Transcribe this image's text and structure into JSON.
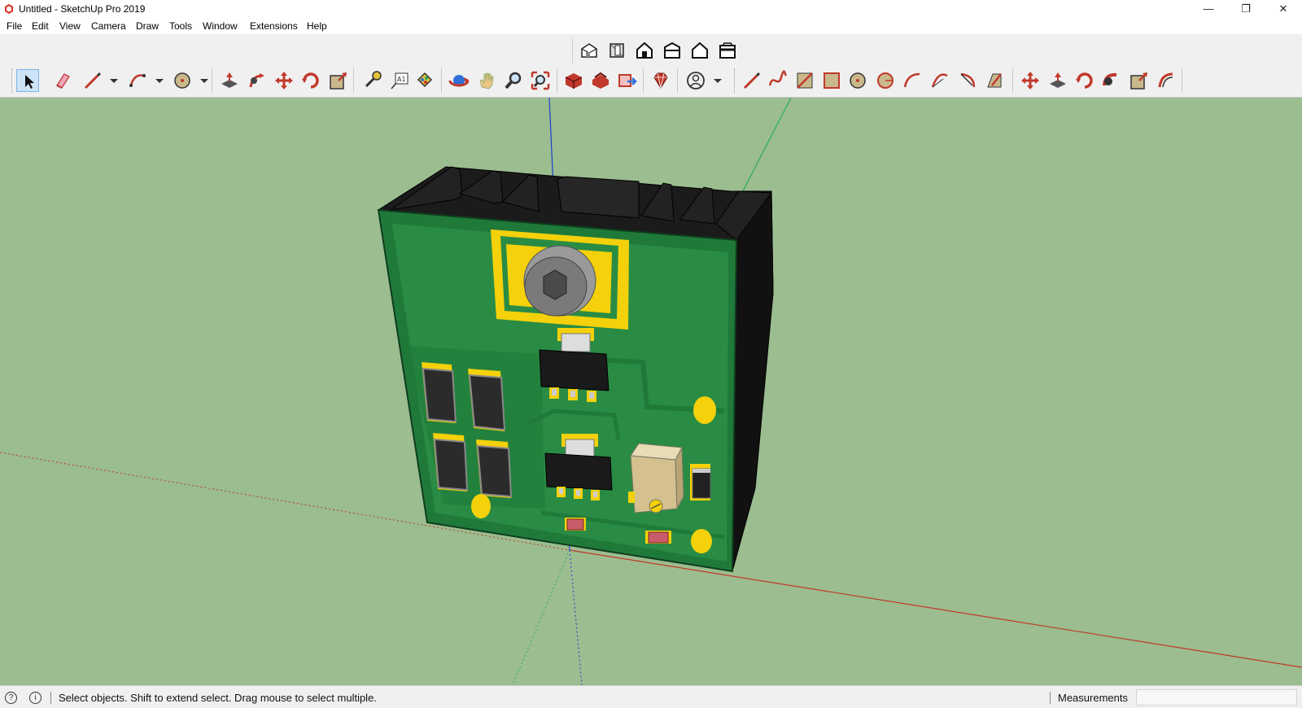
{
  "window": {
    "title": "Untitled - SketchUp Pro 2019",
    "controls": {
      "minimize": "—",
      "maximize": "❐",
      "close": "✕"
    }
  },
  "menubar": {
    "items": [
      "File",
      "Edit",
      "View",
      "Camera",
      "Draw",
      "Tools",
      "Window",
      "Extensions",
      "Help"
    ]
  },
  "toolbars": {
    "views": [
      "iso-view-icon",
      "top-view-icon",
      "front-view-icon",
      "right-view-icon",
      "back-view-icon",
      "left-view-icon"
    ],
    "main_selected_tool": "select-tool-icon",
    "main": [
      "select-tool-icon",
      "eraser-tool-icon",
      "line-tool-icon",
      "arc-tool-icon",
      "circle-tool-icon",
      "push-pull-tool-icon",
      "follow-me-tool-icon",
      "move-tool-icon",
      "rotate-tool-icon",
      "scale-tool-icon",
      "tape-measure-tool-icon",
      "text-tool-icon",
      "paint-bucket-tool-icon",
      "orbit-tool-icon",
      "pan-tool-icon",
      "zoom-tool-icon",
      "zoom-extents-tool-icon",
      "3d-warehouse-icon",
      "extension-warehouse-icon",
      "layout-send-icon",
      "ruby-console-icon",
      "account-icon",
      "freehand-icon",
      "bezier-icon",
      "rectangle-icon",
      "rotated-rectangle-icon",
      "circle-icon",
      "polygon-icon",
      "arc-2pt-icon",
      "arc-3pt-icon",
      "pie-icon",
      "offset-icon",
      "move-icon",
      "push-pull-icon",
      "rotate-icon",
      "follow-me-icon",
      "scale-icon",
      "offset-2-icon"
    ]
  },
  "colors": {
    "viewport_bg": "#9bbd8f",
    "pcb_green": "#1f7a3a",
    "pcb_trace": "#2a8c44",
    "pad_yellow": "#f4d10a",
    "heatsink": "#1b1b1b",
    "axis_red": "#c0392b",
    "axis_green": "#27ae60",
    "axis_blue": "#1f3fd0"
  },
  "statusbar": {
    "hint": "Select objects. Shift to extend select. Drag mouse to select multiple.",
    "measurements_label": "Measurements",
    "measurements_value": ""
  }
}
